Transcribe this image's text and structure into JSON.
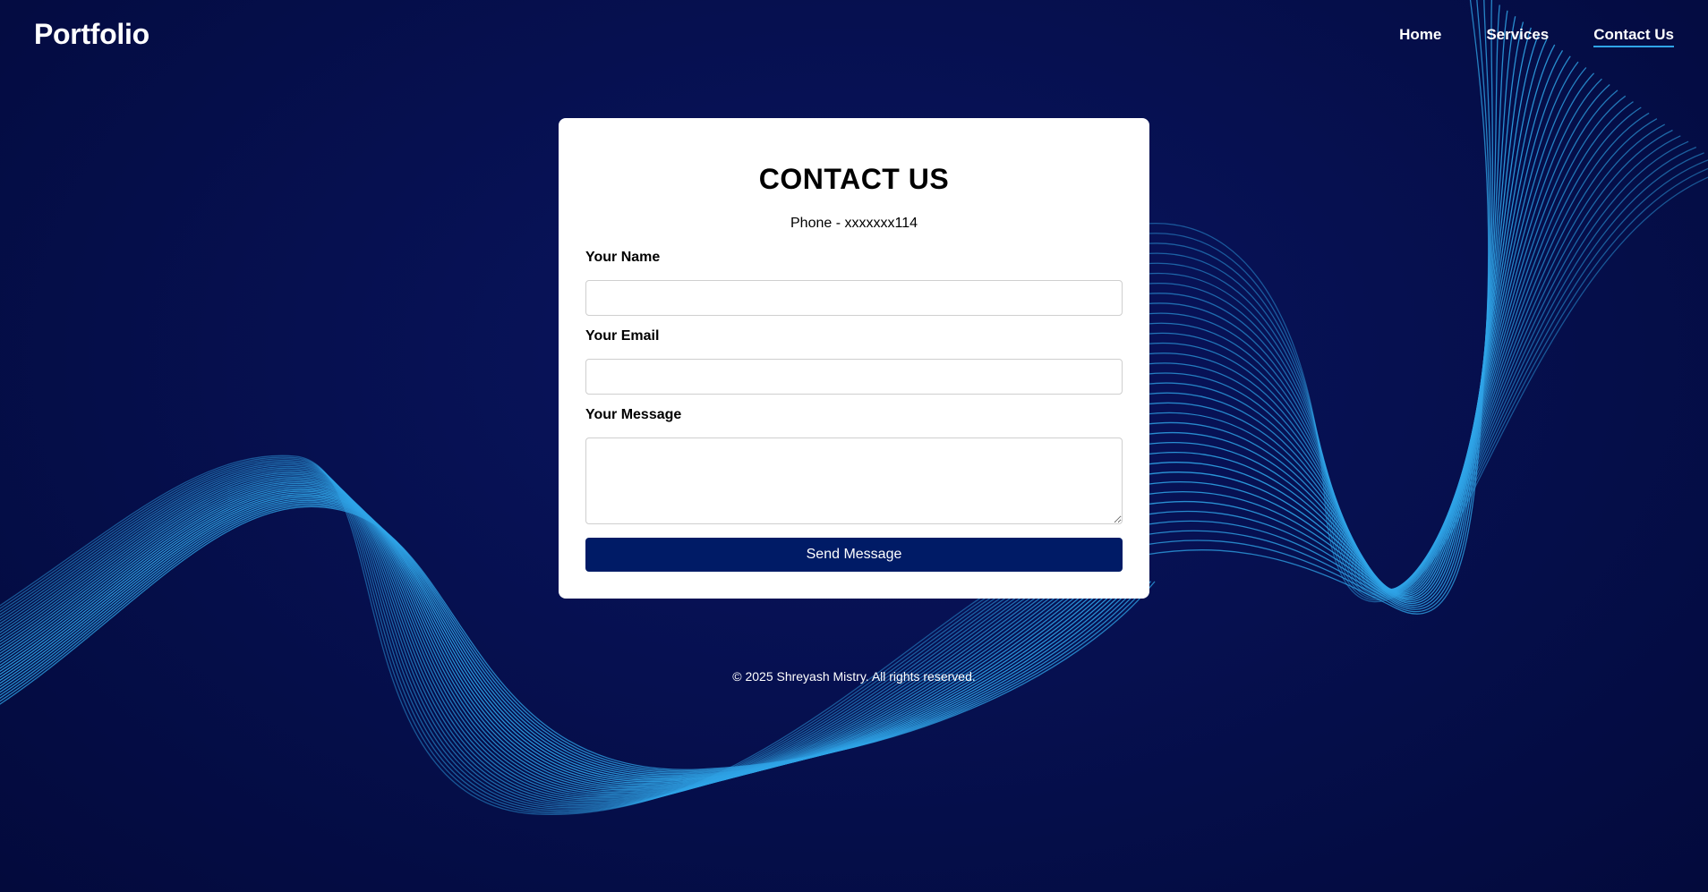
{
  "header": {
    "brand": "Portfolio",
    "nav": [
      {
        "label": "Home",
        "active": false
      },
      {
        "label": "Services",
        "active": false
      },
      {
        "label": "Contact Us",
        "active": true
      }
    ]
  },
  "contact_form": {
    "title": "CONTACT US",
    "phone": "Phone - xxxxxxx114",
    "name_label": "Your Name",
    "name_value": "",
    "email_label": "Your Email",
    "email_value": "",
    "message_label": "Your Message",
    "message_value": "",
    "submit_label": "Send Message"
  },
  "footer": {
    "copyright": "© 2025 Shreyash Mistry. All rights reserved."
  },
  "colors": {
    "background": "#061050",
    "wave": "#2fa4e7",
    "button": "#001b66",
    "card": "#ffffff"
  }
}
